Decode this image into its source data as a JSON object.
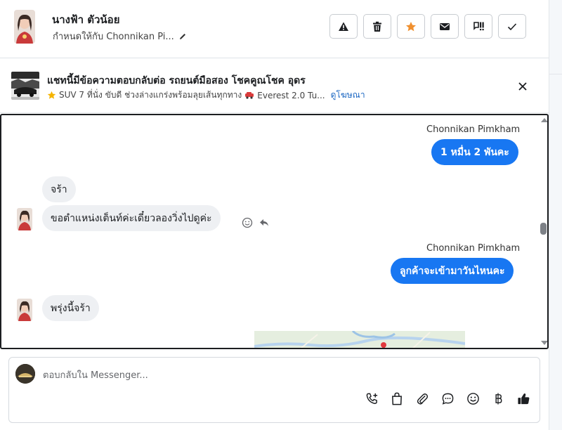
{
  "header": {
    "contact_name": "นางฟ้า ตัวน้อย",
    "assigned_to": "กำหนดให้กับ Chonnikan Pi...",
    "actions": [
      {
        "name": "report-spam",
        "icon": "warning-icon"
      },
      {
        "name": "delete",
        "icon": "trash-icon"
      },
      {
        "name": "star",
        "icon": "star-icon"
      },
      {
        "name": "mark-unread",
        "icon": "envelope-icon"
      },
      {
        "name": "mark-follow-up",
        "icon": "follow-up-icon"
      },
      {
        "name": "mark-done",
        "icon": "checkmark-icon"
      }
    ],
    "star_color": "#f0902f"
  },
  "ad": {
    "title": "แชทนี้มีข้อความตอบกลับต่อ รถยนต์มือสอง โชคคูณโชค อุดร",
    "subtitle": "SUV 7 ที่นั่ง ขับดี ช่วงล่างแกร่งพร้อมลุยเส้นทุกทาง",
    "subtitle_tail": "Everest 2.0 Tu...",
    "view_ad": "ดูโฆษณา"
  },
  "chat": {
    "messages": [
      {
        "direction": "out",
        "sender": "Chonnikan Pimkham",
        "text": "1 หมื่น 2 พันคะ"
      },
      {
        "direction": "in",
        "text": "จร้า"
      },
      {
        "direction": "in",
        "text": "ขอตำแหน่งเต็นท์ค่ะเดี๋ยวลองวิ่งไปดูค่ะ"
      },
      {
        "direction": "out",
        "sender": "Chonnikan Pimkham",
        "text": "ลูกค้าจะเข้ามาวันไหนคะ"
      },
      {
        "direction": "in",
        "text": "พรุ่งนี้จร้า"
      }
    ],
    "outgoing_color": "#1877f2"
  },
  "composer": {
    "placeholder": "ตอบกลับใน Messenger...",
    "tools": [
      "call-add-icon",
      "shopping-bag-icon",
      "paperclip-icon",
      "chat-bubble-icon",
      "emoji-icon",
      "baht-icon",
      "thumbs-up-icon"
    ]
  }
}
